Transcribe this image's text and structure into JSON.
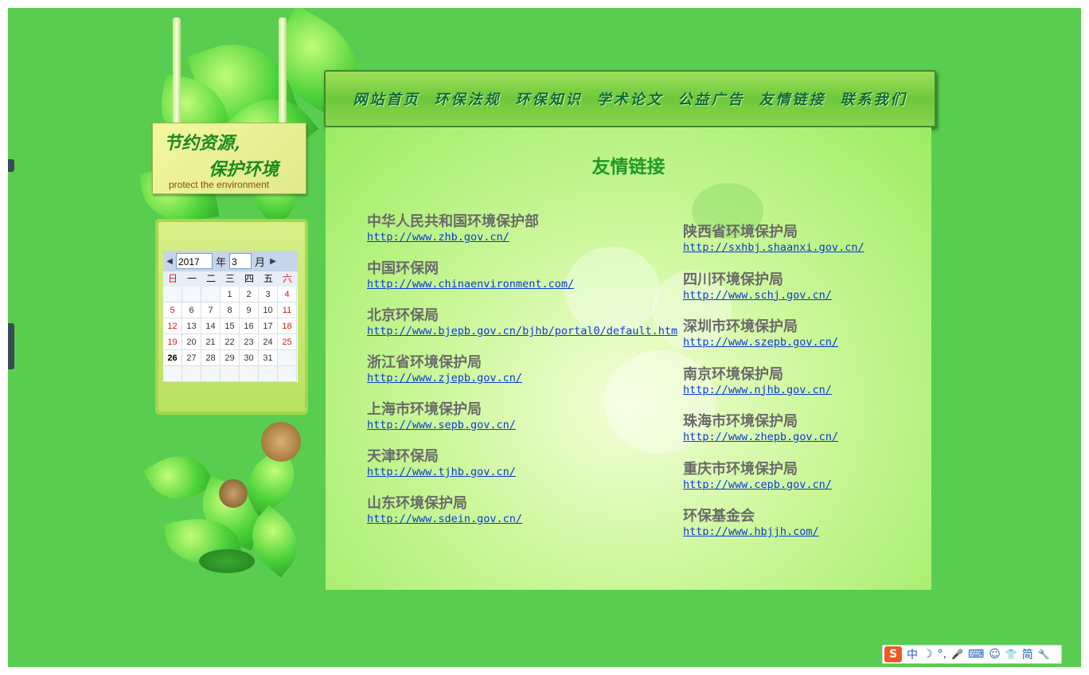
{
  "sign": {
    "line1": "节约资源,",
    "line2": "保护环境",
    "line3": "protect the environment"
  },
  "calendar": {
    "prev_arrow": "◀",
    "next_arrow": "▶",
    "year_value": "2017",
    "year_label": "年",
    "month_value": "3",
    "month_label": "月",
    "weekdays": [
      "日",
      "一",
      "二",
      "三",
      "四",
      "五",
      "六"
    ],
    "weeks": [
      [
        "",
        "",
        "",
        "1",
        "2",
        "3",
        "4"
      ],
      [
        "5",
        "6",
        "7",
        "8",
        "9",
        "10",
        "11"
      ],
      [
        "12",
        "13",
        "14",
        "15",
        "16",
        "17",
        "18"
      ],
      [
        "19",
        "20",
        "21",
        "22",
        "23",
        "24",
        "25"
      ],
      [
        "26",
        "27",
        "28",
        "29",
        "30",
        "31",
        ""
      ],
      [
        "",
        "",
        "",
        "",
        "",
        "",
        ""
      ]
    ],
    "today": "26"
  },
  "nav": {
    "items": [
      "网站首页",
      "环保法规",
      "环保知识",
      "学术论文",
      "公益广告",
      "友情链接",
      "联系我们"
    ]
  },
  "content": {
    "title": "友情链接",
    "left_links": [
      {
        "name": "中华人民共和国环境保护部",
        "url": "http://www.zhb.gov.cn/"
      },
      {
        "name": "中国环保网",
        "url": "http://www.chinaenvironment.com/"
      },
      {
        "name": "北京环保局",
        "url": "http://www.bjepb.gov.cn/bjhb/portal0/default.htm"
      },
      {
        "name": "浙江省环境保护局",
        "url": "http://www.zjepb.gov.cn/"
      },
      {
        "name": "上海市环境保护局",
        "url": "http://www.sepb.gov.cn/"
      },
      {
        "name": "天津环保局",
        "url": "http://www.tjhb.gov.cn/"
      },
      {
        "name": "山东环境保护局",
        "url": "http://www.sdein.gov.cn/"
      }
    ],
    "right_links": [
      {
        "name": "陕西省环境保护局",
        "url": "http://sxhbj.shaanxi.gov.cn/"
      },
      {
        "name": "四川环境保护局",
        "url": "http://www.schj.gov.cn/"
      },
      {
        "name": "深圳市环境保护局",
        "url": "http://www.szepb.gov.cn/"
      },
      {
        "name": "南京环境保护局",
        "url": "http://www.njhb.gov.cn/"
      },
      {
        "name": "珠海市环境保护局",
        "url": "http://www.zhepb.gov.cn/"
      },
      {
        "name": "重庆市环境保护局",
        "url": "http://www.cepb.gov.cn/"
      },
      {
        "name": "环保基金会",
        "url": "http://www.hbjjh.com/"
      }
    ]
  },
  "ime": {
    "logo": "S",
    "lang": "中",
    "moon": "☽",
    "punct": "°,",
    "mic": "🎤",
    "keyboard": "⌨",
    "user": "☺",
    "skin": "👕",
    "mode": "简",
    "tool": "🔧"
  },
  "colors": {
    "page_bg": "#59cd4f",
    "nav_text": "#0f6b3a",
    "title": "#1f9a2a",
    "link": "#0b3bd6",
    "site_name": "#6a6a6a",
    "weekend": "#d41a1a"
  }
}
